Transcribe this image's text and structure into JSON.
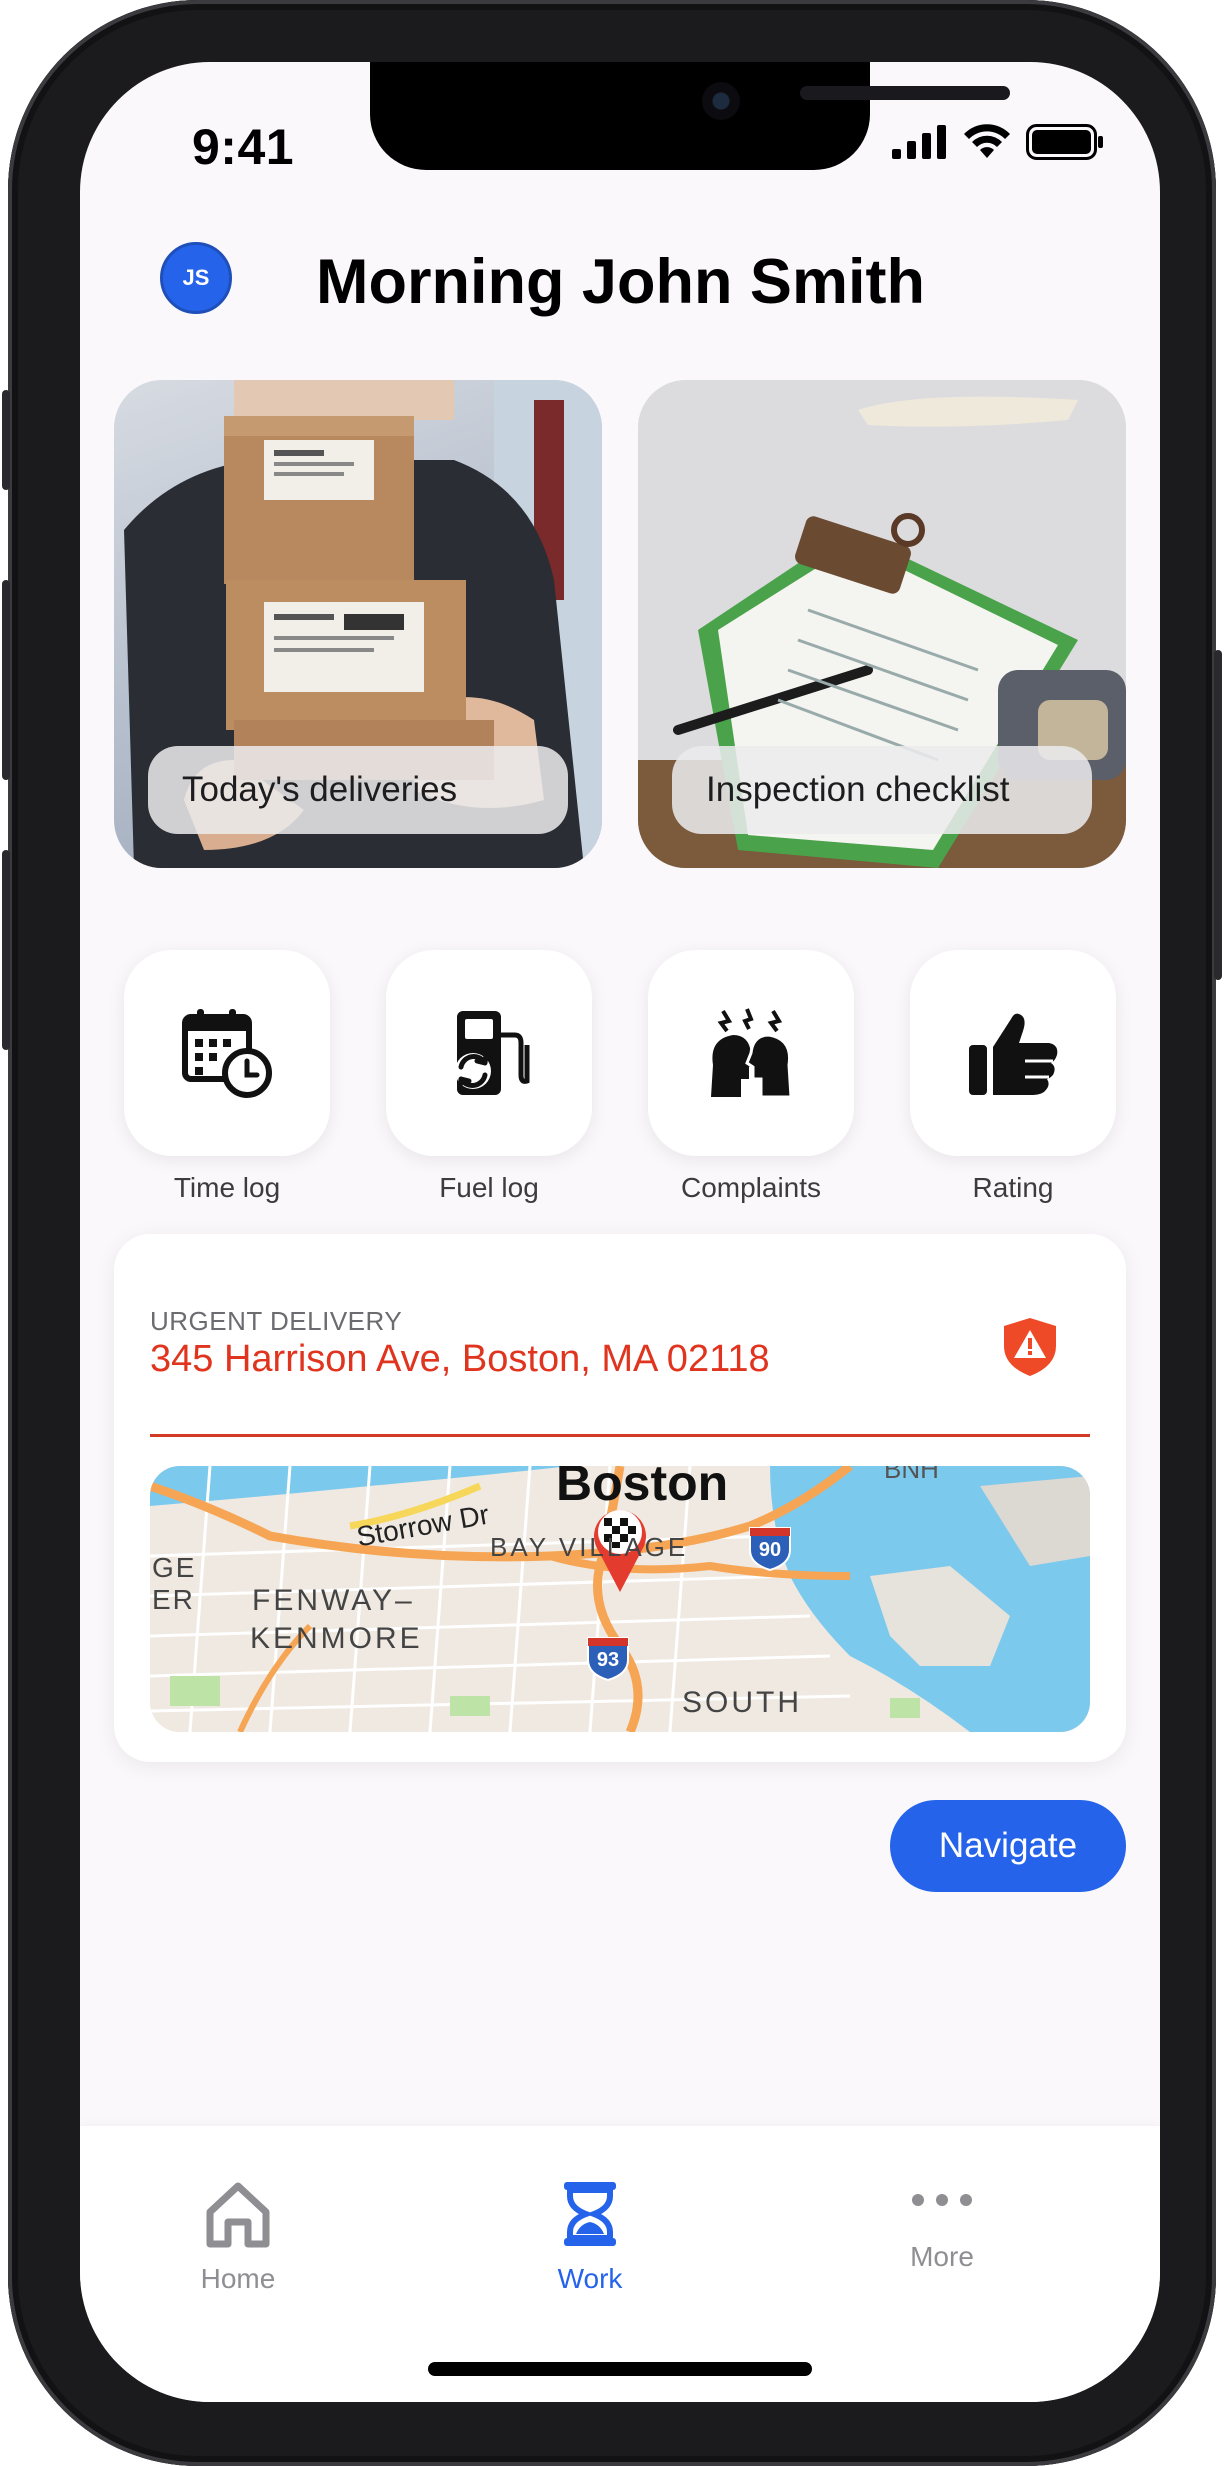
{
  "status_bar": {
    "time": "9:41"
  },
  "header": {
    "avatar_initials": "JS",
    "greeting": "Morning John Smith"
  },
  "feature_cards": [
    {
      "label": "Today's deliveries"
    },
    {
      "label": "Inspection checklist"
    }
  ],
  "quick_actions": [
    {
      "label": "Time log",
      "icon": "calendar-clock-icon"
    },
    {
      "label": "Fuel log",
      "icon": "fuel-pump-icon"
    },
    {
      "label": "Complaints",
      "icon": "complaints-heads-icon"
    },
    {
      "label": "Rating",
      "icon": "thumbs-up-icon"
    }
  ],
  "urgent": {
    "title": "URGENT DELIVERY",
    "address": "345 Harrison Ave, Boston, MA 02118",
    "map_labels": {
      "city": "Boston",
      "storrow": "Storrow Dr",
      "bay_village": "BAY VILLAGE",
      "fenway": "FENWAY–",
      "kenmore": "KENMORE",
      "south": "SOUTH",
      "ge": "GE",
      "er": "ER",
      "bnh": "BNH",
      "i90": "90",
      "i93": "93"
    }
  },
  "navigate_button": "Navigate",
  "tabs": [
    {
      "label": "Home",
      "icon": "home-icon",
      "active": false
    },
    {
      "label": "Work",
      "icon": "hourglass-icon",
      "active": true
    },
    {
      "label": "More",
      "icon": "more-dots-icon",
      "active": false
    }
  ],
  "colors": {
    "accent": "#2563eb",
    "urgent": "#e0341e",
    "inactive": "#8e8e93"
  }
}
